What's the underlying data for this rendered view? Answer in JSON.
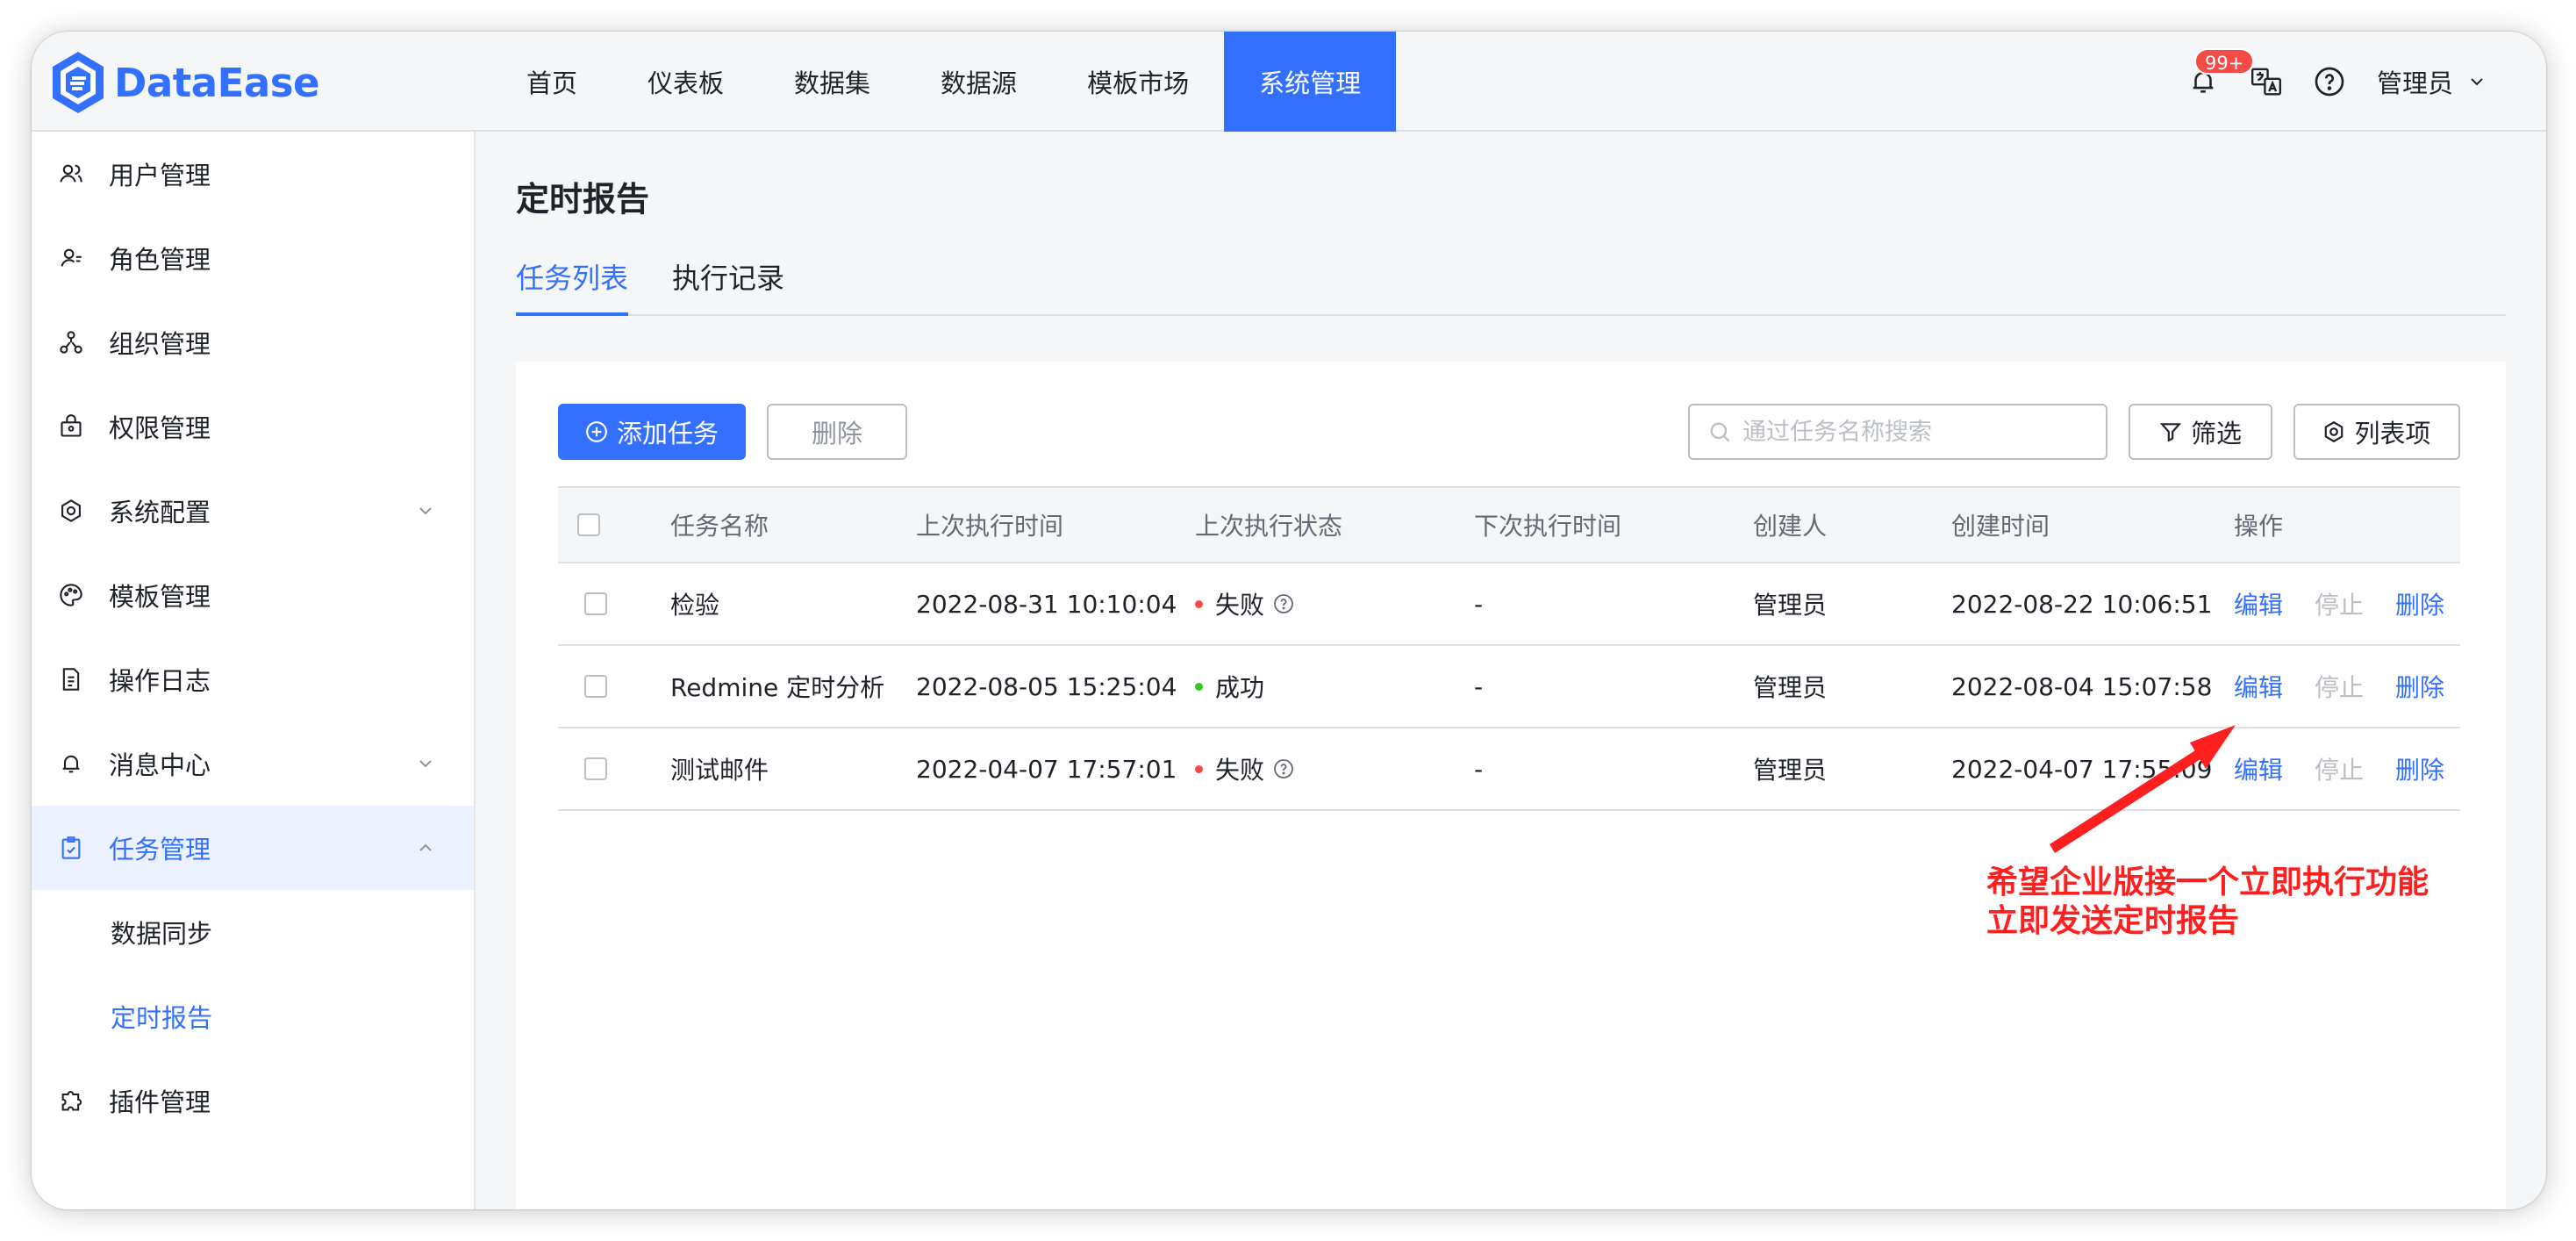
{
  "app": {
    "name": "DataEase",
    "brand_color": "#3370ff"
  },
  "nav": {
    "items": [
      "首页",
      "仪表板",
      "数据集",
      "数据源",
      "模板市场",
      "系统管理"
    ],
    "active_index": 5
  },
  "header": {
    "notification_badge": "99+",
    "icons": [
      "bell-icon",
      "translate-icon",
      "help-icon"
    ],
    "user": "管理员"
  },
  "sidebar": {
    "items": [
      {
        "label": "用户管理",
        "icon": "users-icon"
      },
      {
        "label": "角色管理",
        "icon": "role-icon"
      },
      {
        "label": "组织管理",
        "icon": "org-icon"
      },
      {
        "label": "权限管理",
        "icon": "lock-icon"
      },
      {
        "label": "系统配置",
        "icon": "gear-icon",
        "expandable": true
      },
      {
        "label": "模板管理",
        "icon": "palette-icon"
      },
      {
        "label": "操作日志",
        "icon": "log-icon"
      },
      {
        "label": "消息中心",
        "icon": "bell-icon",
        "expandable": true
      },
      {
        "label": "任务管理",
        "icon": "task-icon",
        "expanded": true
      },
      {
        "label": "插件管理",
        "icon": "plugin-icon"
      }
    ],
    "sub_items": [
      {
        "label": "数据同步",
        "active": false
      },
      {
        "label": "定时报告",
        "active": true
      }
    ]
  },
  "page": {
    "title": "定时报告",
    "tabs": [
      {
        "label": "任务列表",
        "active": true
      },
      {
        "label": "执行记录",
        "active": false
      }
    ]
  },
  "toolbar": {
    "add_label": "添加任务",
    "delete_label": "删除",
    "search_placeholder": "通过任务名称搜索",
    "filter_label": "筛选",
    "columns_label": "列表项"
  },
  "table": {
    "columns": [
      "任务名称",
      "上次执行时间",
      "上次执行状态",
      "下次执行时间",
      "创建人",
      "创建时间",
      "操作"
    ],
    "rows": [
      {
        "name": "检验",
        "last_run": "2022-08-31 10:10:04",
        "status": "失败",
        "status_color": "#f54a45",
        "has_help": true,
        "next_run": "-",
        "creator": "管理员",
        "created": "2022-08-22 10:06:51"
      },
      {
        "name": "Redmine 定时分析",
        "last_run": "2022-08-05 15:25:04",
        "status": "成功",
        "status_color": "#34c724",
        "has_help": false,
        "next_run": "-",
        "creator": "管理员",
        "created": "2022-08-04 15:07:58"
      },
      {
        "name": "测试邮件",
        "last_run": "2022-04-07 17:57:01",
        "status": "失败",
        "status_color": "#f54a45",
        "has_help": true,
        "next_run": "-",
        "creator": "管理员",
        "created": "2022-04-07 17:55:09"
      }
    ],
    "actions": {
      "edit": "编辑",
      "stop": "停止",
      "delete": "删除"
    }
  },
  "annotation": {
    "lines": [
      "希望企业版接一个立即执行功能",
      "立即发送定时报告"
    ],
    "color": "#ff1f1f"
  }
}
